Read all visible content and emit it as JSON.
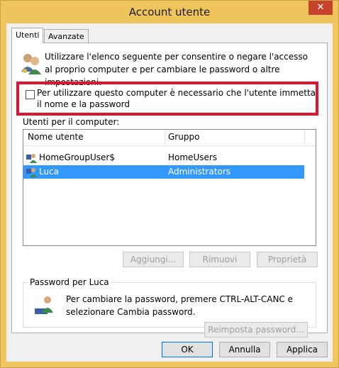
{
  "window": {
    "title": "Account utente",
    "close_glyph": "✕"
  },
  "tabs": [
    {
      "label": "Utenti"
    },
    {
      "label": "Avanzate"
    }
  ],
  "info_text": "Utilizzare l'elenco seguente per consentire o negare l'accesso al proprio computer e per cambiare le password o altre impostazioni.",
  "require_login": {
    "label": "Per utilizzare questo computer è necessario che l'utente immetta il nome e la password",
    "checked": false
  },
  "users_label": "Utenti per il computer:",
  "table": {
    "columns": [
      "Nome utente",
      "Gruppo"
    ],
    "rows": [
      {
        "name": "HomeGroupUser$",
        "group": "HomeUsers",
        "selected": false
      },
      {
        "name": "Luca",
        "group": "Administrators",
        "selected": true
      }
    ]
  },
  "user_buttons": {
    "add": "Aggiungi...",
    "remove": "Rimuovi",
    "properties": "Proprietà"
  },
  "password_group": {
    "title": "Password per Luca",
    "text": "Per cambiare la password, premere CTRL-ALT-CANC e selezionare Cambia password.",
    "reset_button": "Reimposta password..."
  },
  "footer": {
    "ok": "OK",
    "cancel": "Annulla",
    "apply": "Applica"
  },
  "colors": {
    "highlight": "#3399ff",
    "red_outline": "#e2132e",
    "title_bar": "#f0c45c"
  }
}
